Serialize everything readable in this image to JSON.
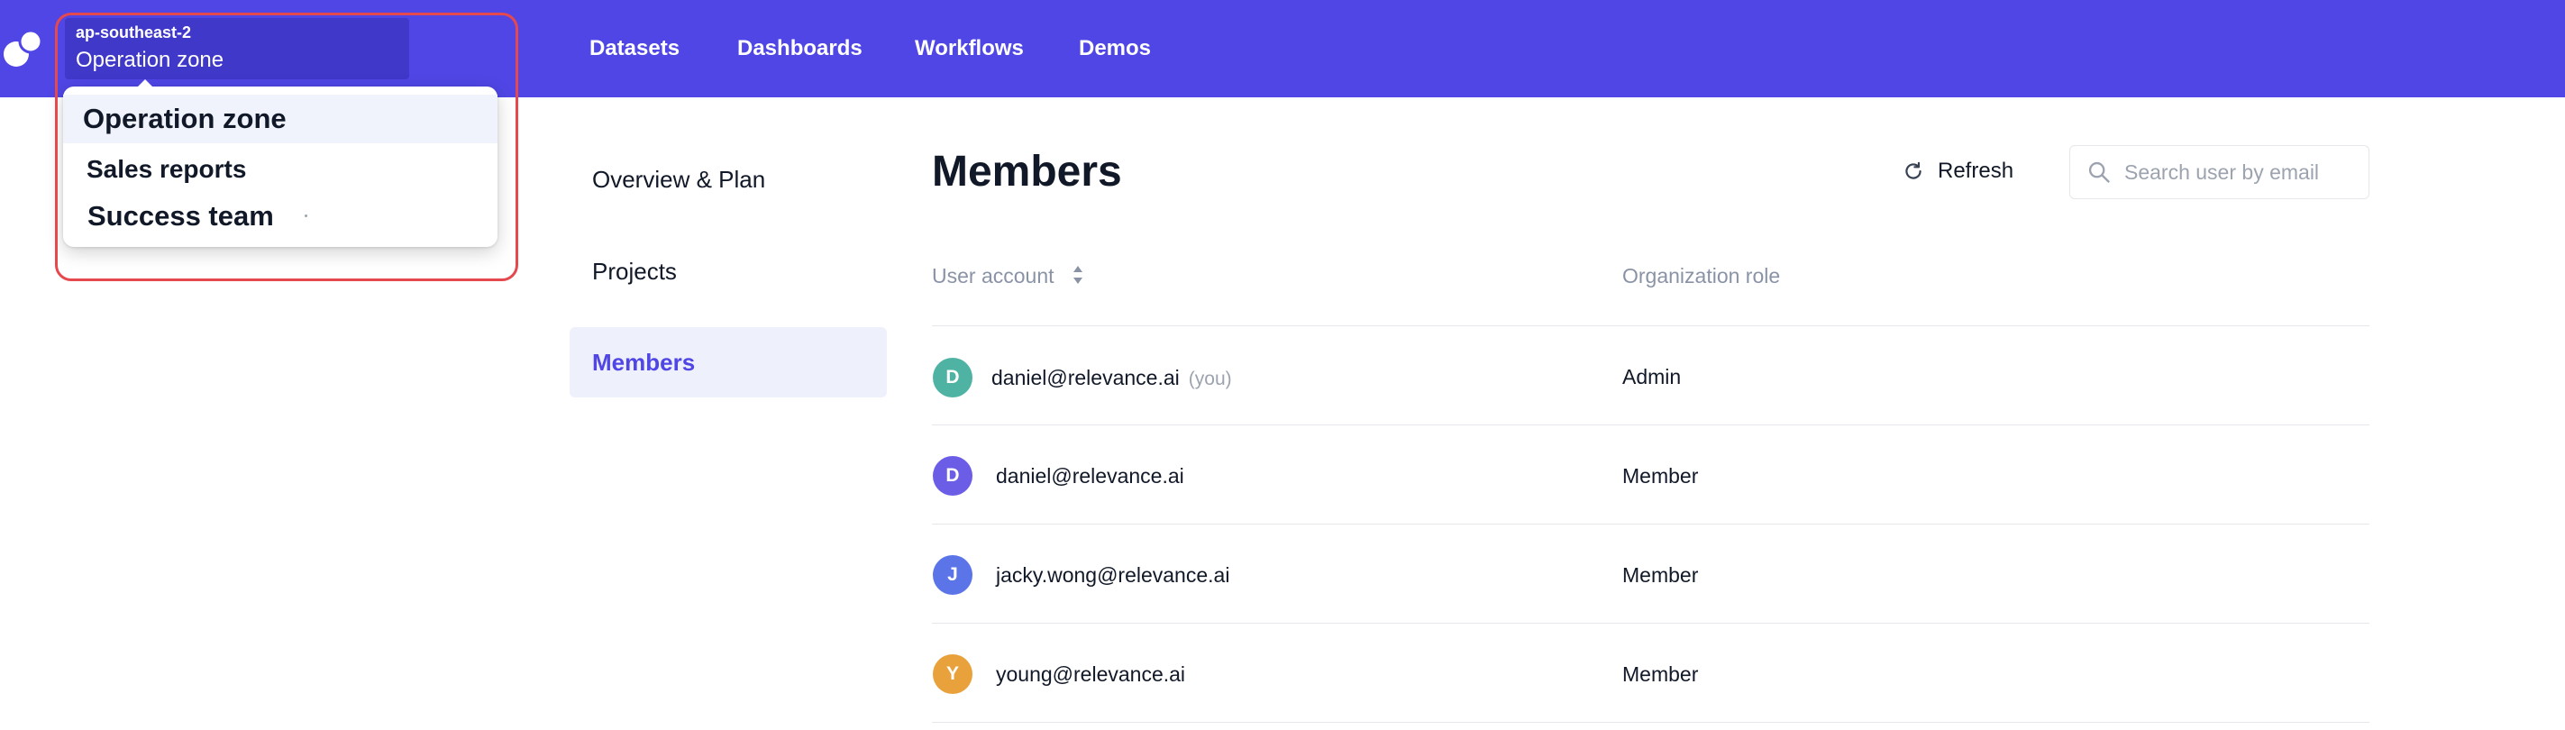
{
  "header": {
    "workspace": {
      "region": "ap-southeast-2",
      "name": "Operation zone"
    },
    "nav": [
      "Datasets",
      "Dashboards",
      "Workflows",
      "Demos"
    ]
  },
  "dropdown": {
    "items": [
      "Operation zone",
      "Sales reports",
      "Success team"
    ],
    "selected": "Operation zone"
  },
  "sidebar": {
    "items": [
      "Overview & Plan",
      "Projects",
      "Members"
    ],
    "active": "Members"
  },
  "main": {
    "title": "Members",
    "refresh_label": "Refresh",
    "search_placeholder": "Search user by email",
    "columns": [
      "User account",
      "Organization role"
    ],
    "rows": [
      {
        "initial": "D",
        "email": "daniel@relevance.ai",
        "suffix": "(you)",
        "role": "Admin",
        "avatar_color": "#4fb3a4"
      },
      {
        "initial": "D",
        "email": "daniel@relevance.ai",
        "suffix": "",
        "role": "Member",
        "avatar_color": "#6b5de6"
      },
      {
        "initial": "J",
        "email": "jacky.wong@relevance.ai",
        "suffix": "",
        "role": "Member",
        "avatar_color": "#5b74e8"
      },
      {
        "initial": "Y",
        "email": "young@relevance.ai",
        "suffix": "",
        "role": "Member",
        "avatar_color": "#e9a23b"
      }
    ]
  },
  "colors": {
    "brand": "#4f46e5",
    "highlight": "#e5484d"
  }
}
